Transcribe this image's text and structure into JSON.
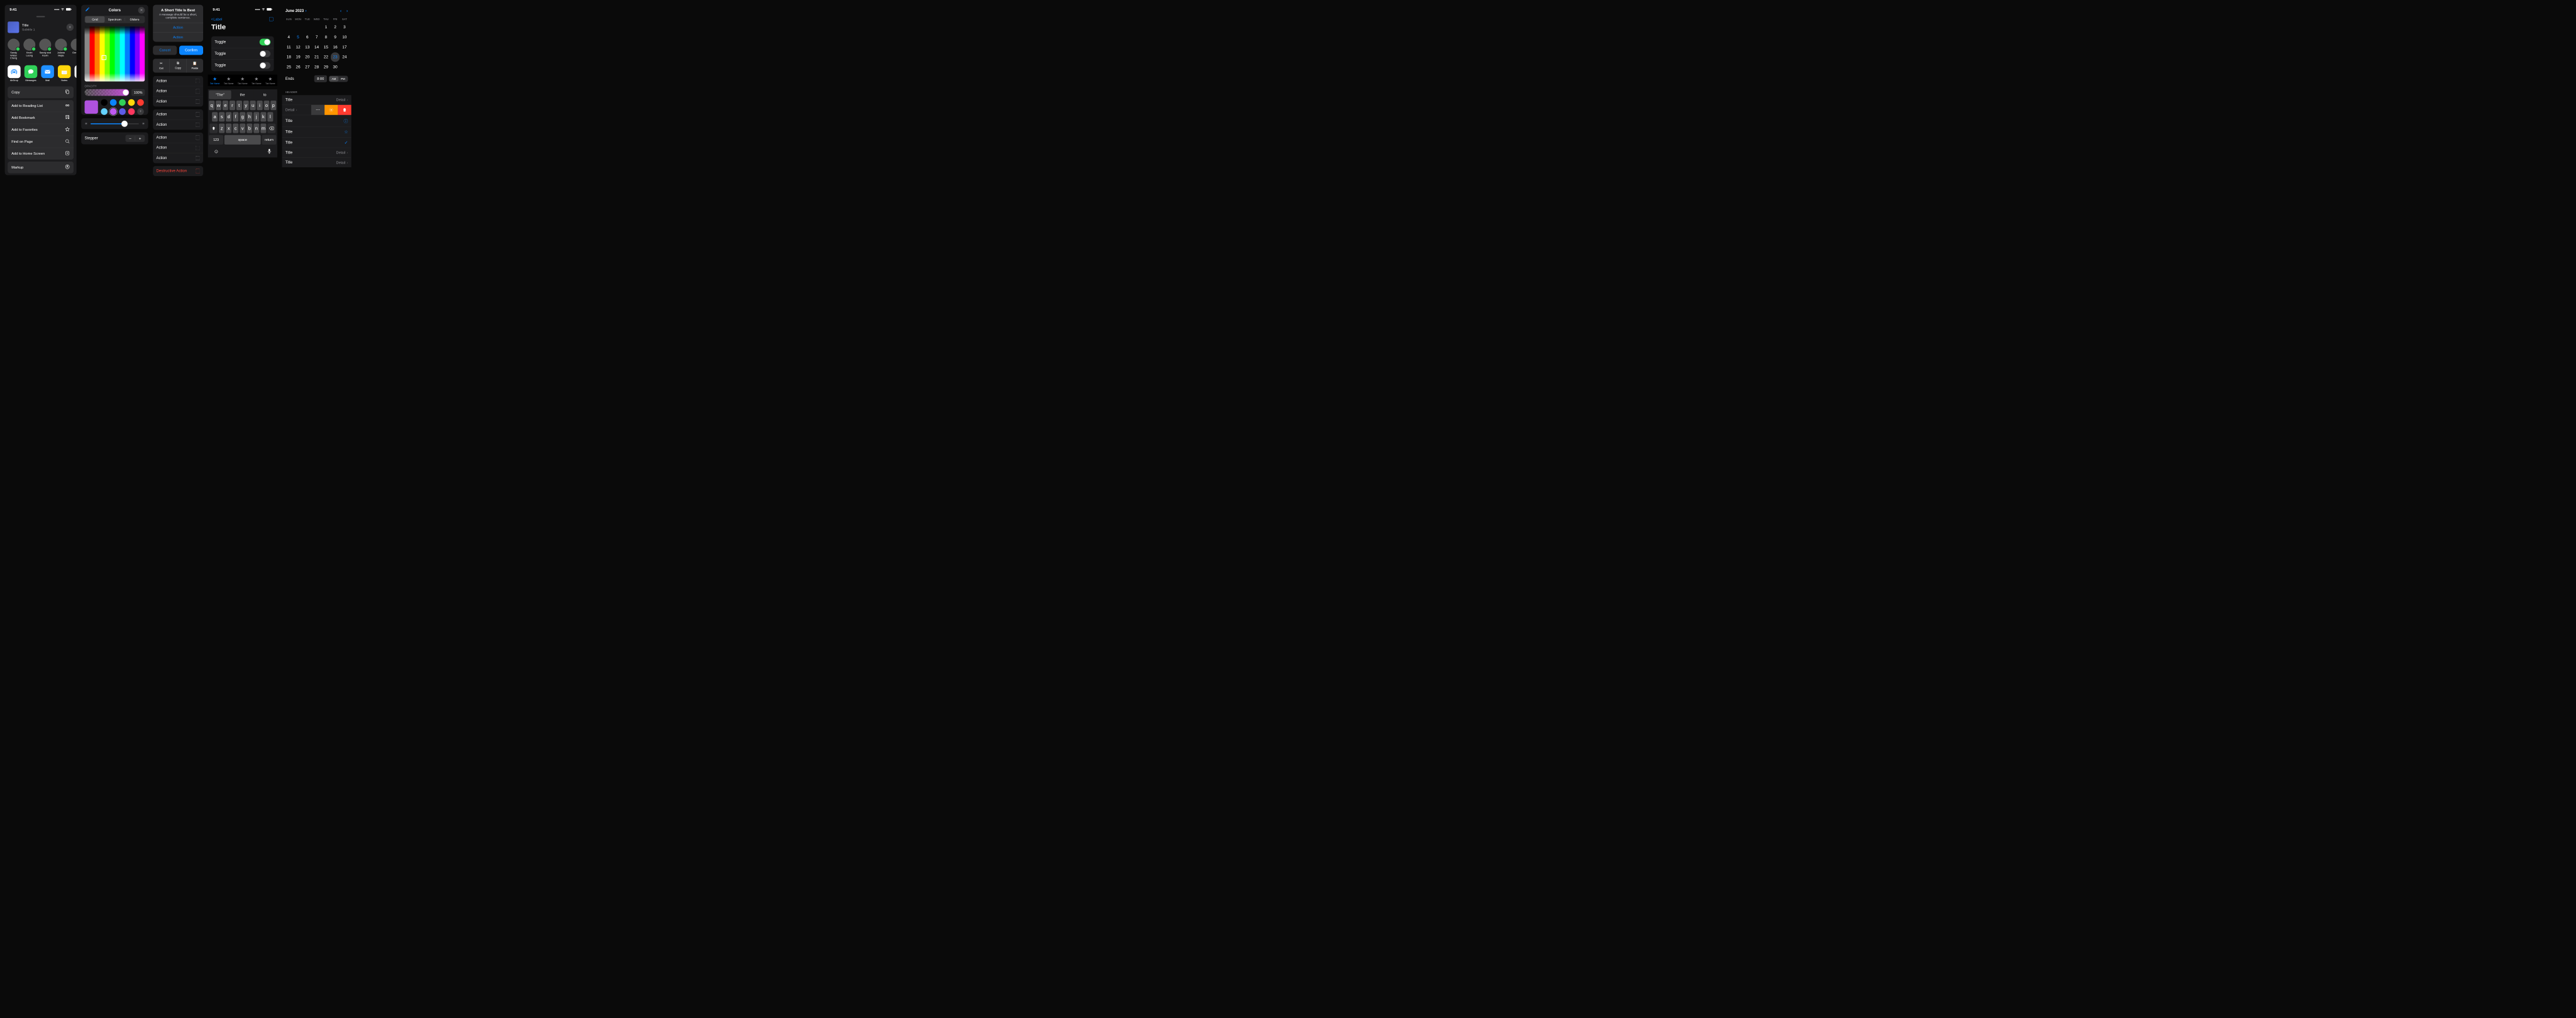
{
  "status": {
    "time": "9:41"
  },
  "share": {
    "title": "Title",
    "subtitle": "Subtitle 1",
    "people": [
      {
        "name": "Sandy Wilder Cheng"
      },
      {
        "name": "Kevin Leong"
      },
      {
        "name": "Sandy and Kevin"
      },
      {
        "name": "Juliana Mejia"
      },
      {
        "name": "Greg Ap"
      }
    ],
    "apps": [
      {
        "name": "AirDrop",
        "bg": "#fff",
        "fg": "#0a84ff"
      },
      {
        "name": "Messages",
        "bg": "#30d158",
        "fg": "#fff"
      },
      {
        "name": "Mail",
        "bg": "#1f8fff",
        "fg": "#fff"
      },
      {
        "name": "Notes",
        "bg": "#ffd60a",
        "fg": "#333"
      },
      {
        "name": "Remin",
        "bg": "#fff",
        "fg": "#333"
      }
    ],
    "copy": "Copy",
    "actions": [
      {
        "label": "Add to Reading List"
      },
      {
        "label": "Add Bookmark"
      },
      {
        "label": "Add to Favorites"
      },
      {
        "label": "Find on Page"
      },
      {
        "label": "Add to Home Screen"
      }
    ],
    "markup": "Markup"
  },
  "colors": {
    "title": "Colors",
    "tabs": [
      "Grid",
      "Spectrum",
      "Sliders"
    ],
    "opacityLabel": "OPACITY",
    "opacityValue": "100%",
    "swatches": [
      "#000",
      "#0a84ff",
      "#30d158",
      "#ffd60a",
      "#ff3b30",
      "#64d2ff",
      "#bf5af2",
      "#5e5ce6",
      "#ff375f"
    ],
    "stepper": "Stepper"
  },
  "alert": {
    "title": "A Short Title Is Best",
    "message": "A message should be a short, complete sentence.",
    "action": "Action",
    "cancel": "Cancel",
    "confirm": "Confirm",
    "cut": "Cut",
    "copy": "Copy",
    "paste": "Paste",
    "actionLabel": "Action",
    "destructive": "Destructive Action"
  },
  "settings": {
    "back": "Label",
    "title": "Title",
    "toggle": "Toggle",
    "tabName": "Tab Name"
  },
  "keyboard": {
    "sug1": "“The”",
    "sug2": "the",
    "sug3": "to",
    "row1": [
      "q",
      "w",
      "e",
      "r",
      "t",
      "y",
      "u",
      "i",
      "o",
      "p"
    ],
    "row2": [
      "a",
      "s",
      "d",
      "f",
      "g",
      "h",
      "j",
      "k",
      "l"
    ],
    "row3": [
      "z",
      "x",
      "c",
      "v",
      "b",
      "n",
      "m"
    ],
    "numKey": "123",
    "space": "space",
    "return": "return"
  },
  "calendar": {
    "month": "June 2023",
    "weekdays": [
      "SUN",
      "MON",
      "TUE",
      "WED",
      "THU",
      "FRI",
      "SAT"
    ],
    "ends": "Ends",
    "time": "8:00",
    "am": "AM",
    "pm": "PM"
  },
  "table": {
    "header": "HEADER",
    "title": "Title",
    "detail": "Detail"
  }
}
